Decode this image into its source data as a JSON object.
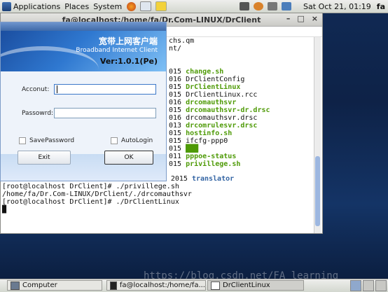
{
  "top_panel": {
    "menus": [
      "Applications",
      "Places",
      "System"
    ],
    "clock": "Sat Oct 21, 01:19",
    "user": "fa"
  },
  "terminal": {
    "title": "fa@localhost:/home/fa/Dr.Com-LINUX/DrClient",
    "lines_right": [
      {
        "t": "chs.qm",
        "c": ""
      },
      {
        "t": "nt/",
        "c": ""
      },
      {
        "t": "",
        "c": ""
      },
      {
        "t": "",
        "c": ""
      },
      {
        "t": "015 change.sh",
        "c": "g"
      },
      {
        "t": "016 DrClientConfig",
        "c": ""
      },
      {
        "t": "015 DrClientLinux",
        "c": "g"
      },
      {
        "t": "015 DrClientLinux.rcc",
        "c": ""
      },
      {
        "t": "016 drcomauthsvr",
        "c": "g"
      },
      {
        "t": "015 drcomauthsvr-dr.drsc",
        "c": "g"
      },
      {
        "t": "016 drcomauthsvr.drsc",
        "c": ""
      },
      {
        "t": "013 drcomrulesvr.drsc",
        "c": "g"
      },
      {
        "t": "015 hostinfo.sh",
        "c": "g"
      },
      {
        "t": "015 ifcfg-ppp0",
        "c": ""
      },
      {
        "t": "015 ",
        "c": "hl"
      },
      {
        "t": "011 pppoe-status",
        "c": "g"
      },
      {
        "t": "015 privillege.sh",
        "c": "g"
      }
    ],
    "full_lines": [
      "drwxr-xr-x. 2 root root    4096 Dec  1  2015 translator",
      "[root@localhost DrClient]# ./privillege.sh",
      "/home/fa/Dr.Com-LINUX/DrClient/./drcomauthsvr",
      "[root@localhost DrClient]# ./DrClientLinux",
      "█"
    ]
  },
  "dialog": {
    "brand_cn": "宽带上网客户端",
    "brand_en": "Broadband Internet Client",
    "version": "Ver:1.0.1(Pe)",
    "account_label": "Acconut:",
    "password_label": "Passowrd:",
    "save_password": "SavePassword",
    "auto_login": "AutoLogin",
    "exit_label": "Exit",
    "ok_label": "OK"
  },
  "taskbar": {
    "items": [
      "Computer",
      "fa@localhost:/home/fa...",
      "DrClientLinux"
    ]
  },
  "watermark": "https://blog.csdn.net/FA_learning"
}
